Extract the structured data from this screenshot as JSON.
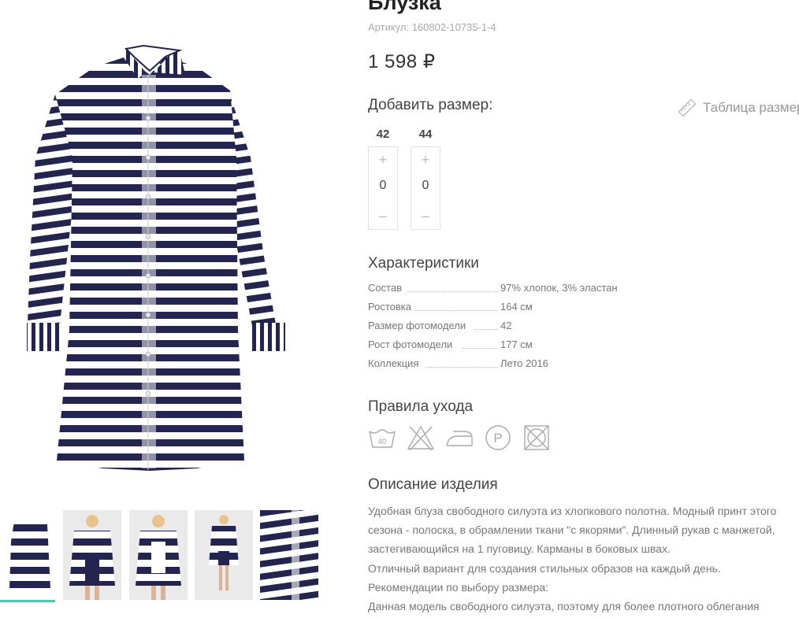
{
  "product": {
    "title": "Блузка",
    "article": "Артикул: 160802-10735-1-4",
    "price": "1 598 ₽"
  },
  "sizes": {
    "heading": "Добавить размер:",
    "table_link": "Таблица размеров",
    "items": [
      {
        "label": "42",
        "plus": "+",
        "qty": "0",
        "minus": "–"
      },
      {
        "label": "44",
        "plus": "+",
        "qty": "0",
        "minus": "–"
      }
    ]
  },
  "specs": {
    "heading": "Характеристики",
    "rows": [
      {
        "name": "Состав",
        "value": "97% хлопок, 3% эластан"
      },
      {
        "name": "Ростовка",
        "value": "164 см"
      },
      {
        "name": "Размер фотомодели",
        "value": "42"
      },
      {
        "name": "Рост фотомодели",
        "value": "177 см"
      },
      {
        "name": "Коллекция",
        "value": "Лето 2016"
      }
    ]
  },
  "care": {
    "heading": "Правила ухода",
    "wash_temp": "40",
    "dryclean_letter": "P",
    "icons": [
      "wash-40-icon",
      "no-bleach-icon",
      "iron-icon",
      "dry-clean-p-icon",
      "no-tumble-dry-icon"
    ]
  },
  "description": {
    "heading": "Описание изделия",
    "lines": [
      "Удобная блуза свободного силуэта из хлопкового полотна. Модный принт этого",
      "сезона - полоска, в обрамлении ткани \"с якорями\". Длинный рукав с манжетой,",
      "застегивающийся на 1 пуговицу. Карманы в боковых швах.",
      "Отличный вариант для создания стильных образов на каждый день.",
      "Рекомендации по выбору размера:",
      "Данная модель свободного силуэта, поэтому для более плотного облегания"
    ]
  },
  "colors": {
    "stripe": "#24254f",
    "accent": "#55c1b2",
    "muted_text": "#aaaaaa"
  }
}
